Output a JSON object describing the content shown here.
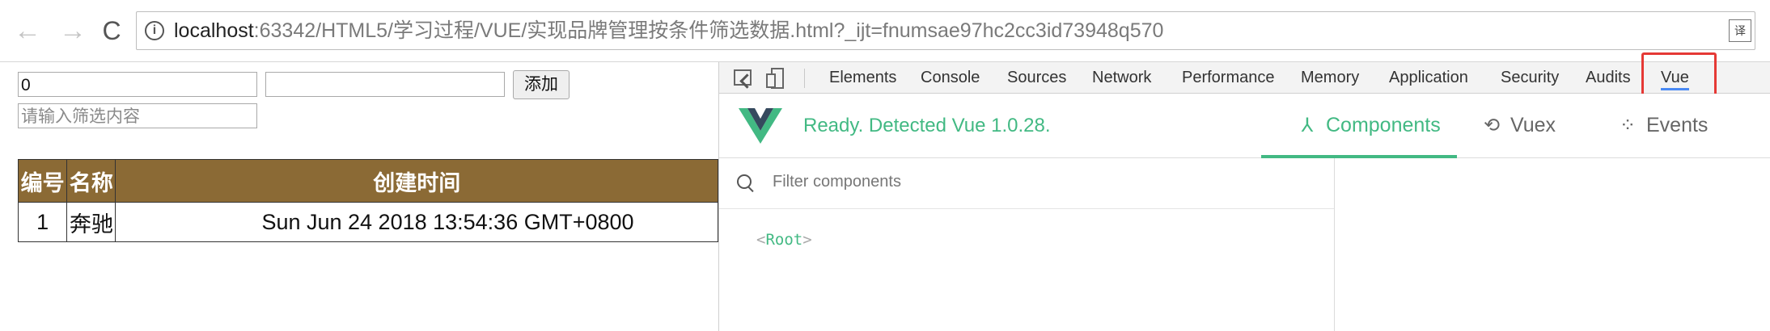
{
  "browser": {
    "back_glyph": "←",
    "forward_glyph": "→",
    "reload_glyph": "C",
    "info_glyph": "i",
    "url_host": "localhost",
    "url_path": ":63342/HTML5/学习过程/VUE/实现品牌管理按条件筛选数据.html?_ijt=fnumsae97hc2cc3id73948q570",
    "translate_glyph": "译"
  },
  "page": {
    "id_input_value": "0",
    "name_input_value": "",
    "add_button_label": "添加",
    "filter_placeholder": "请输入筛选内容",
    "table": {
      "headers": [
        "编号",
        "名称",
        "创建时间"
      ],
      "rows": [
        {
          "id": "1",
          "name": "奔驰",
          "created": "Sun Jun 24 2018 13:54:36 GMT+0800"
        }
      ]
    }
  },
  "devtools": {
    "tabs": [
      "Elements",
      "Console",
      "Sources",
      "Network",
      "Performance",
      "Memory",
      "Application",
      "Security",
      "Audits",
      "Vue"
    ],
    "active_tab": "Vue",
    "vue": {
      "status": "Ready. Detected Vue 1.0.28.",
      "nav": {
        "components": "Components",
        "vuex": "Vuex",
        "events": "Events"
      },
      "filter_placeholder": "Filter components",
      "root_label": "Root",
      "colors": {
        "accent": "#42b983",
        "logo_dark": "#35495e"
      }
    },
    "highlight_color": "#e53935"
  }
}
